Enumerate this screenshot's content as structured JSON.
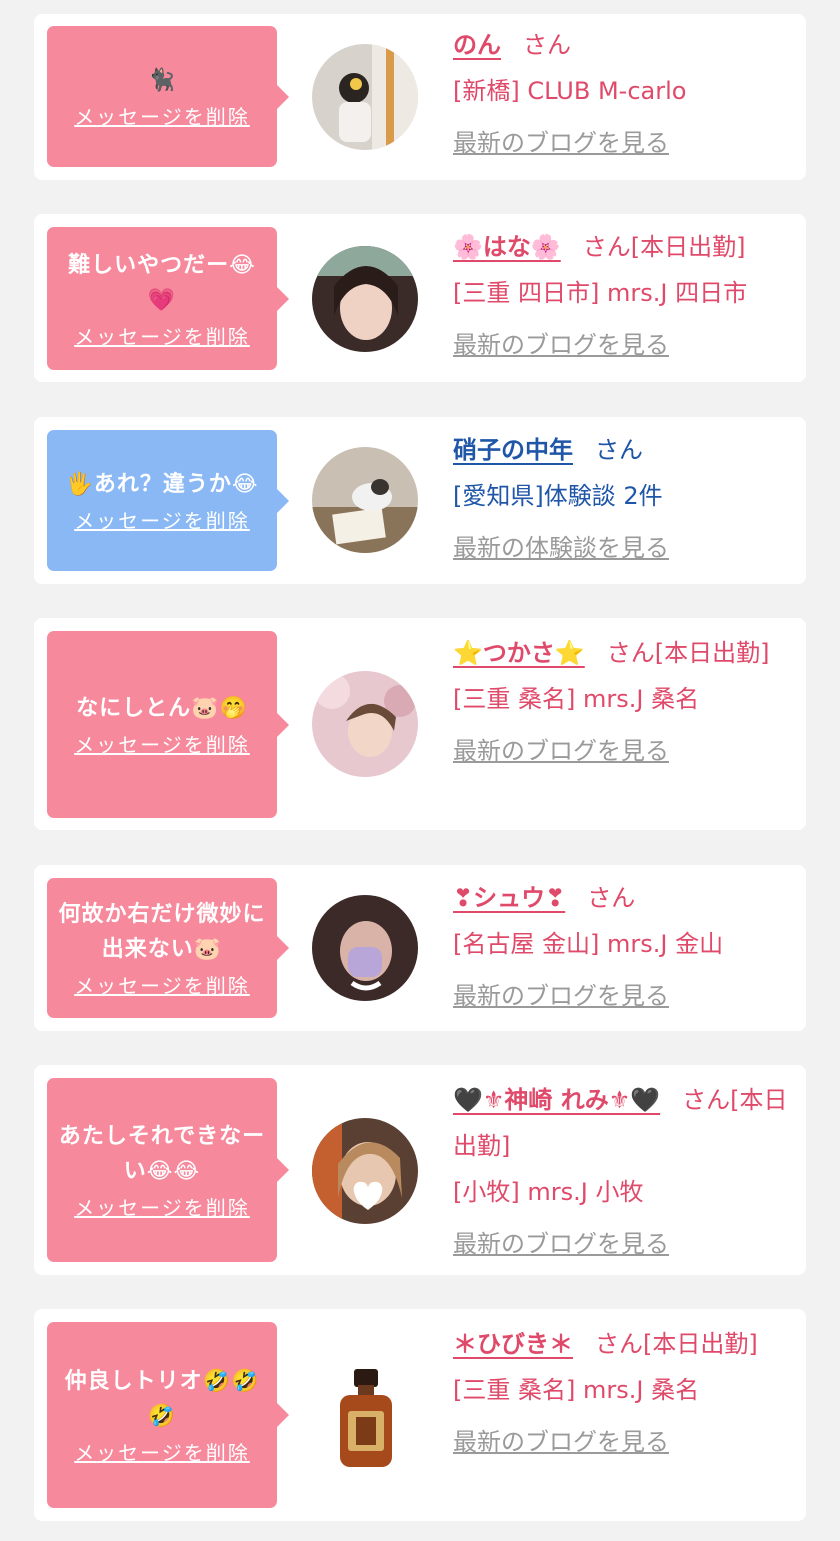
{
  "delete_label": "メッセージを削除",
  "items": [
    {
      "message": "🐈‍⬛",
      "name": "のん",
      "suffix": "さん",
      "shop": "[新橋] CLUB M-carlo",
      "link": "最新のブログを見る",
      "bubble": "pink",
      "theme": "pink"
    },
    {
      "message": "難しいやつだー😂💗",
      "name": "🌸はな🌸",
      "suffix": "さん[本日出勤]",
      "shop": "[三重 四日市] mrs.J 四日市",
      "link": "最新のブログを見る",
      "bubble": "pink",
      "theme": "pink"
    },
    {
      "message": "🖐あれ？違うか😂",
      "name": "硝子の中年",
      "suffix": "さん",
      "shop": "[愛知県]体験談 2件",
      "link": "最新の体験談を見る",
      "bubble": "blue",
      "theme": "blue"
    },
    {
      "message": "なにしとん🐷🤭",
      "name": "⭐つかさ⭐",
      "suffix": "さん[本日出勤]",
      "shop": "[三重 桑名] mrs.J 桑名",
      "link": "最新のブログを見る",
      "bubble": "pink",
      "theme": "pink"
    },
    {
      "message": "何故か右だけ微妙に出来ない🐷",
      "name": "❣シュウ❣",
      "suffix": "さん",
      "shop": "[名古屋 金山] mrs.J 金山",
      "link": "最新のブログを見る",
      "bubble": "pink",
      "theme": "pink"
    },
    {
      "message": "あたしそれできなーい😂😂",
      "name": "🖤⚜神崎 れみ⚜🖤",
      "suffix": "さん[本日出勤]",
      "shop": "[小牧] mrs.J 小牧",
      "link": "最新のブログを見る",
      "bubble": "pink",
      "theme": "pink"
    },
    {
      "message": "仲良しトリオ🤣🤣🤣",
      "name": "＊ひびき＊",
      "suffix": "さん[本日出勤]",
      "shop": "[三重 桑名] mrs.J 桑名",
      "link": "最新のブログを見る",
      "bubble": "pink",
      "theme": "pink"
    }
  ]
}
